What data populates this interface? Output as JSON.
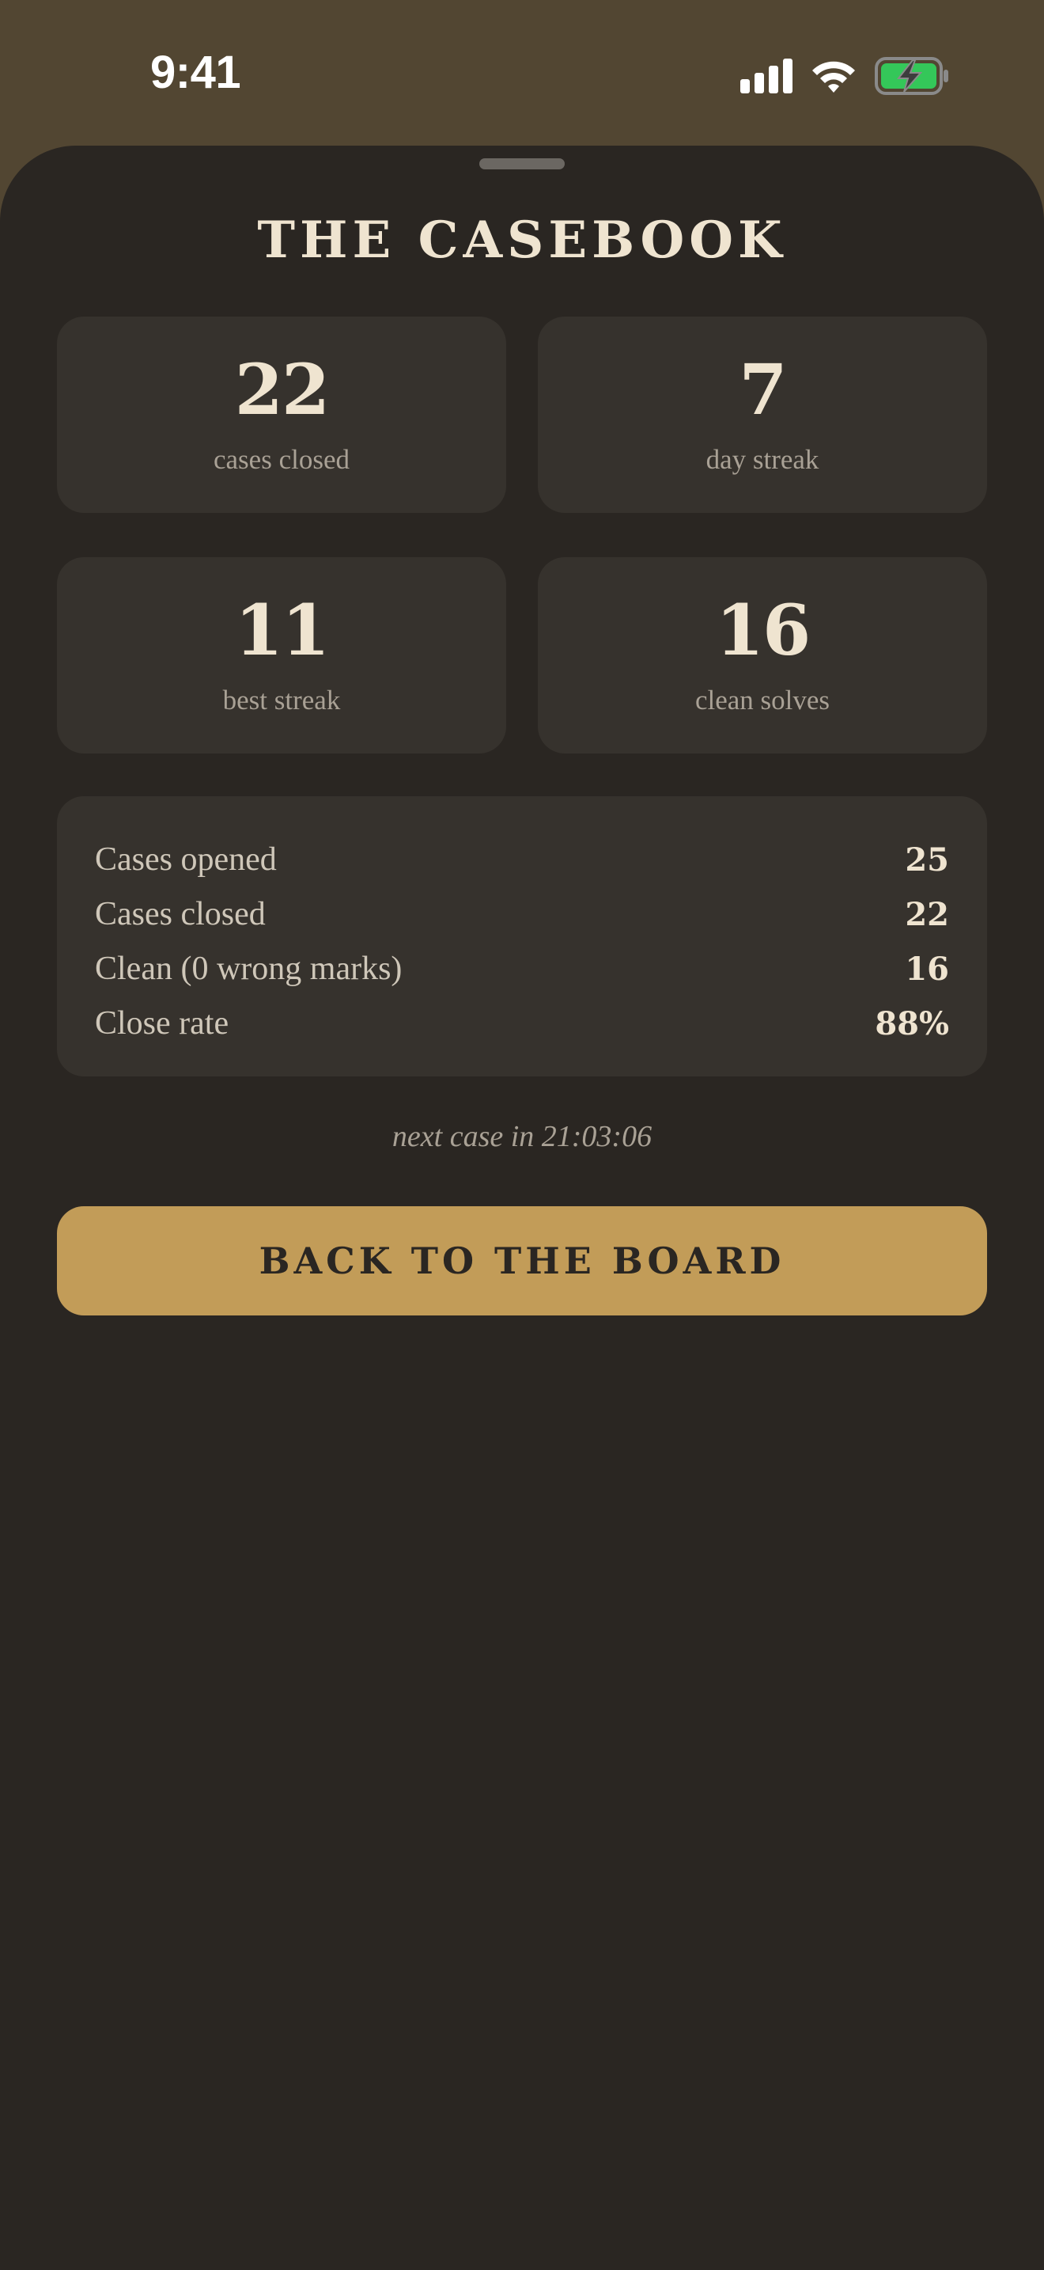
{
  "status_bar": {
    "time": "9:41",
    "icons": [
      "cellular-signal-icon",
      "wifi-icon",
      "battery-charging-icon"
    ],
    "battery_color": "#34c759"
  },
  "sheet": {
    "title": "THE CASEBOOK"
  },
  "stats": [
    {
      "value": "22",
      "label": "cases closed"
    },
    {
      "value": "7",
      "label": "day streak"
    },
    {
      "value": "11",
      "label": "best streak"
    },
    {
      "value": "16",
      "label": "clean solves"
    }
  ],
  "summary": {
    "rows": [
      {
        "label": "Cases opened",
        "value": "25"
      },
      {
        "label": "Cases closed",
        "value": "22"
      },
      {
        "label": "Clean (0 wrong marks)",
        "value": "16"
      },
      {
        "label": "Close rate",
        "value": "88%"
      }
    ]
  },
  "next_case": "next case in 21:03:06",
  "back_button": {
    "label": "BACK TO THE BOARD"
  },
  "colors": {
    "header_background": "#524632",
    "sheet_background": "#2a2622",
    "card_background": "#36322d",
    "text_primary": "#efe4d0",
    "text_secondary": "#a9a195",
    "accent": "#c29c58"
  }
}
